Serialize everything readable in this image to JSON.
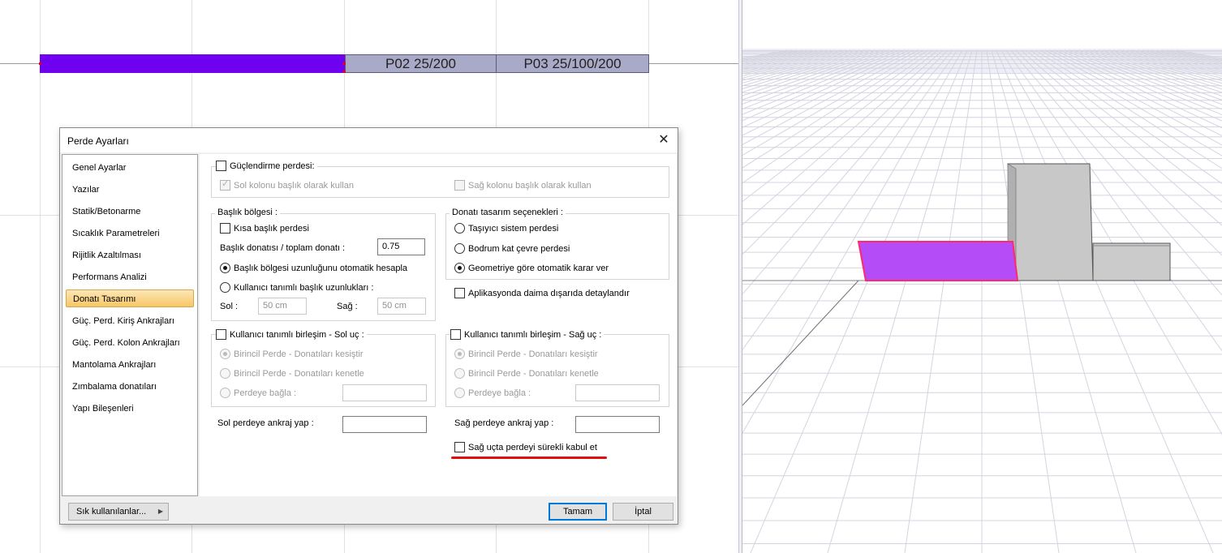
{
  "plan": {
    "walls": [
      {
        "label": "P02 25/200"
      },
      {
        "label": "P03 25/100/200"
      }
    ]
  },
  "dialog": {
    "title": "Perde Ayarları",
    "close_glyph": "✕",
    "nav": [
      {
        "label": "Genel Ayarlar"
      },
      {
        "label": "Yazılar"
      },
      {
        "label": "Statik/Betonarme"
      },
      {
        "label": "Sıcaklık Parametreleri"
      },
      {
        "label": "Rijitlik Azaltılması"
      },
      {
        "label": "Performans Analizi"
      },
      {
        "label": "Donatı Tasarımı",
        "active": true
      },
      {
        "label": "Güç. Perd. Kiriş Ankrajları"
      },
      {
        "label": "Güç. Perd. Kolon Ankrajları"
      },
      {
        "label": "Mantolama Ankrajları"
      },
      {
        "label": "Zımbalama donatıları"
      },
      {
        "label": "Yapı Bileşenleri"
      }
    ],
    "guclendirme": {
      "title": "Güçlendirme perdesi:",
      "sol_kolon": "Sol kolonu başlık olarak kullan",
      "sag_kolon": "Sağ kolonu başlık olarak kullan"
    },
    "baslik": {
      "title": "Başlık bölgesi :",
      "kisa": "Kısa başlık perdesi",
      "oran_label": "Başlık donatısı / toplam donatı :",
      "oran_value": "0.75",
      "otomatik": "Başlık bölgesi uzunluğunu otomatik hesapla",
      "kullanici": "Kullanıcı tanımlı başlık uzunlukları :",
      "sol_label": "Sol :",
      "sol_value": "50 cm",
      "sag_label": "Sağ :",
      "sag_value": "50 cm"
    },
    "donati": {
      "title": "Donatı tasarım seçenekleri :",
      "opt1": "Taşıyıcı sistem perdesi",
      "opt2": "Bodrum kat çevre perdesi",
      "opt3": "Geometriye göre otomatik karar ver"
    },
    "aplikasyon": "Aplikasyonda daima dışarıda detaylandır",
    "sol_uc": {
      "title": "Kullanıcı tanımlı birleşim - Sol uç :",
      "opt1": "Birincil Perde - Donatıları kesiştir",
      "opt2": "Birincil Perde - Donatıları kenetle",
      "opt3": "Perdeye bağla :"
    },
    "sag_uc": {
      "title": "Kullanıcı tanımlı birleşim - Sağ uç :",
      "opt1": "Birincil Perde - Donatıları kesiştir",
      "opt2": "Birincil Perde - Donatıları kenetle",
      "opt3": "Perdeye bağla :"
    },
    "sol_ankraj": "Sol perdeye ankraj yap :",
    "sag_ankraj": "Sağ perdeye ankraj yap :",
    "surekli": "Sağ uçta perdeyi sürekli kabul et",
    "footer": {
      "sik": "Sık kullanılanlar...",
      "tamam": "Tamam",
      "iptal": "İptal"
    }
  },
  "colors": {
    "selected_wall": "#7000f0",
    "selected_wall_3d": "#b44cf8",
    "highlight_line": "#e01010"
  }
}
